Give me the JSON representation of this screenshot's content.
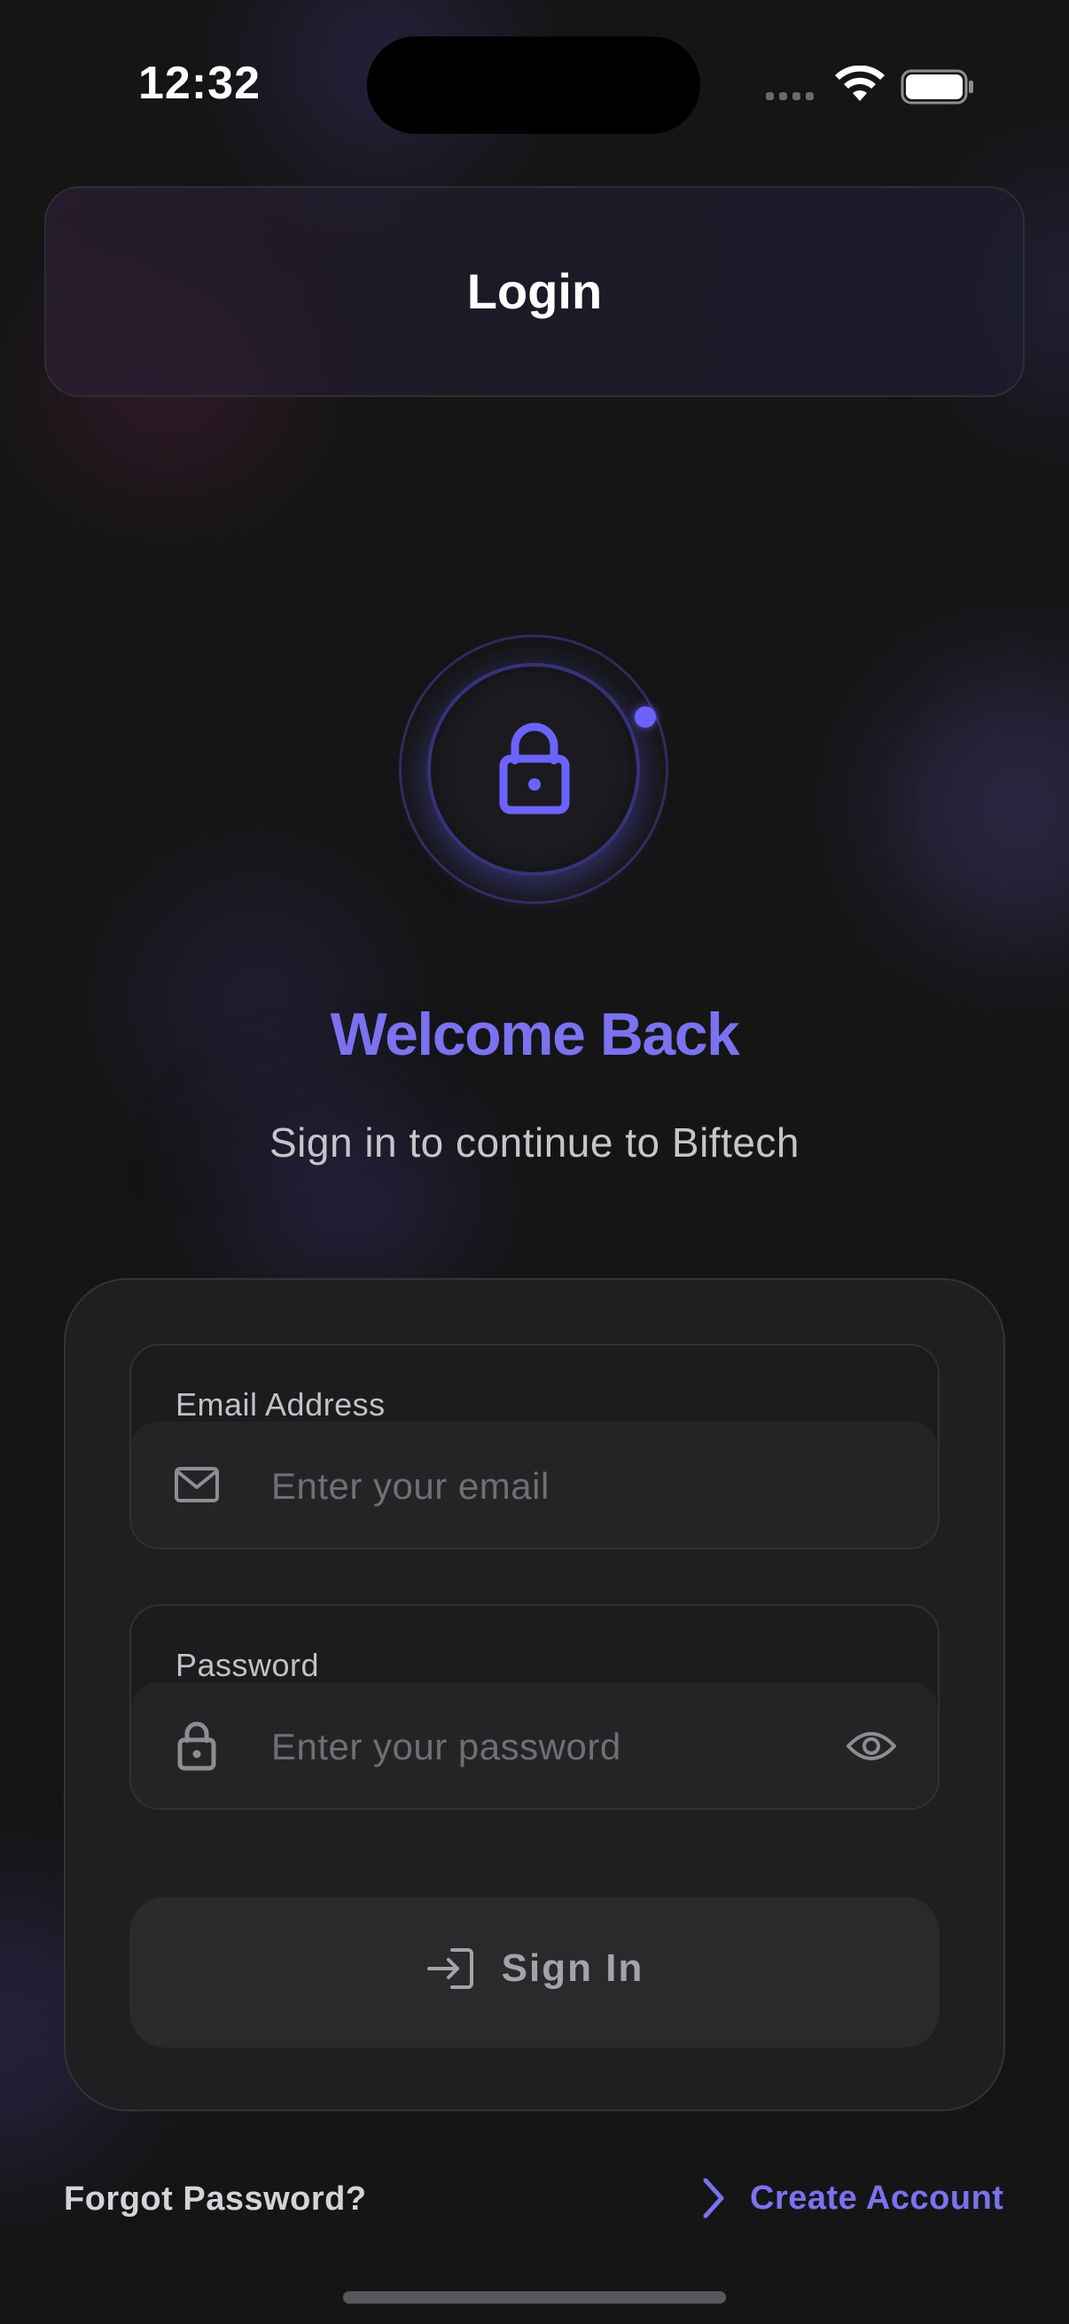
{
  "status_bar": {
    "time": "12:32"
  },
  "header": {
    "title": "Login"
  },
  "hero": {
    "icon": "lock-icon",
    "title": "Welcome Back",
    "subtitle": "Sign in to continue to Biftech"
  },
  "form": {
    "email": {
      "label": "Email Address",
      "placeholder": "Enter your email",
      "value": "",
      "icon": "mail-icon"
    },
    "password": {
      "label": "Password",
      "placeholder": "Enter your password",
      "value": "",
      "icon": "lock-icon",
      "toggle_icon": "eye-icon"
    },
    "submit": {
      "label": "Sign In",
      "icon": "login-arrow-icon"
    }
  },
  "footer": {
    "forgot_label": "Forgot Password?",
    "create_label": "Create Account",
    "create_icon": "chevron-right-icon"
  },
  "colors": {
    "accent": "#7b72f0",
    "background": "#151516",
    "card": "#1f1f21"
  }
}
